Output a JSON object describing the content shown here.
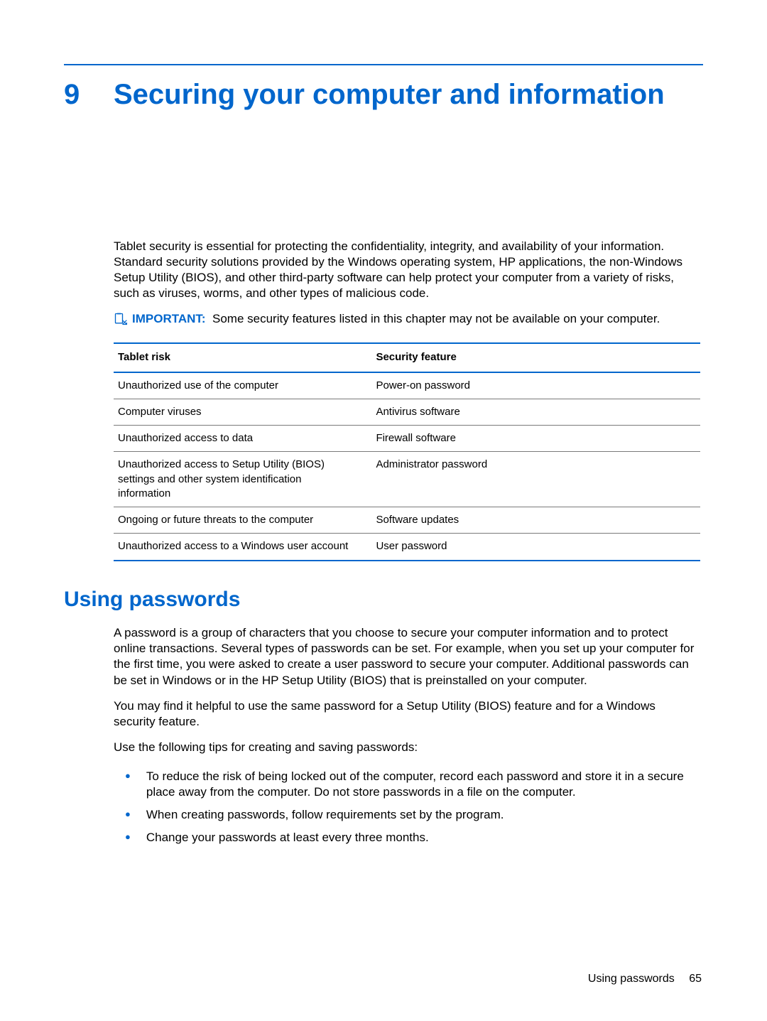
{
  "chapter": {
    "number": "9",
    "title": "Securing your computer and information"
  },
  "intro_para": "Tablet security is essential for protecting the confidentiality, integrity, and availability of your information. Standard security solutions provided by the Windows operating system, HP applications, the non-Windows Setup Utility (BIOS), and other third-party software can help protect your computer from a variety of risks, such as viruses, worms, and other types of malicious code.",
  "note": {
    "label": "IMPORTANT:",
    "text": "Some security features listed in this chapter may not be available on your computer."
  },
  "table": {
    "headers": [
      "Tablet risk",
      "Security feature"
    ],
    "rows": [
      [
        "Unauthorized use of the computer",
        "Power-on password"
      ],
      [
        "Computer viruses",
        "Antivirus software"
      ],
      [
        "Unauthorized access to data",
        "Firewall software"
      ],
      [
        "Unauthorized access to Setup Utility (BIOS) settings and other system identification information",
        "Administrator password"
      ],
      [
        "Ongoing or future threats to the computer",
        "Software updates"
      ],
      [
        "Unauthorized access to a Windows user account",
        "User password"
      ]
    ]
  },
  "section2": {
    "heading": "Using passwords"
  },
  "pw_para1": "A password is a group of characters that you choose to secure your computer information and to protect online transactions. Several types of passwords can be set. For example, when you set up your computer for the first time, you were asked to create a user password to secure your computer. Additional passwords can be set in Windows or in the HP Setup Utility (BIOS) that is preinstalled on your computer.",
  "pw_para2": "You may find it helpful to use the same password for a Setup Utility (BIOS) feature and for a Windows security feature.",
  "pw_para3": "Use the following tips for creating and saving passwords:",
  "tips": [
    "To reduce the risk of being locked out of the computer, record each password and store it in a secure place away from the computer. Do not store passwords in a file on the computer.",
    "When creating passwords, follow requirements set by the program.",
    "Change your passwords at least every three months."
  ],
  "footer": {
    "section": "Using passwords",
    "page": "65"
  }
}
